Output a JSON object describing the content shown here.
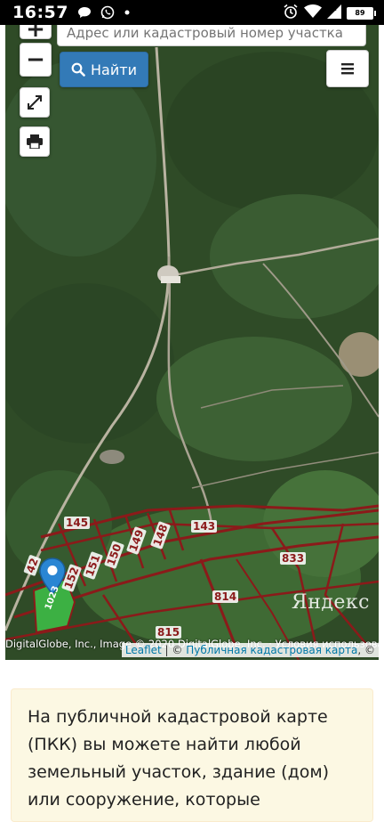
{
  "status_bar": {
    "time": "16:57",
    "battery": "89"
  },
  "map": {
    "zoom_in": "+",
    "zoom_out": "−",
    "search": {
      "placeholder": "Адрес или кадастровый номер участка"
    },
    "find_button": "Найти",
    "parcel_labels": [
      "145",
      "143",
      "42",
      "151",
      "150",
      "149",
      "148",
      "152",
      "833",
      "814",
      "815"
    ],
    "marker_label": "1023",
    "yandex_logo": "Яндекс",
    "attribution_left": "DigitalGlobe, Inc., Image © 2020 DigitalGlobe, Inc. · Условия использования",
    "attribution_leaflet": "Leaflet",
    "attribution_separator": " | © ",
    "attribution_pkk": "Публичная кадастровая карта",
    "attribution_tail": ", ©",
    "colors": {
      "button_blue": "#337ab7",
      "parcel_border": "#8b1a1a",
      "selected_parcel": "#3cb043",
      "marker": "#2a86d3"
    }
  },
  "info_card": {
    "text": "На публичной кадастровой карте (ПКК) вы можете найти любой земельный участок, здание (дом) или сооружение, которые"
  }
}
